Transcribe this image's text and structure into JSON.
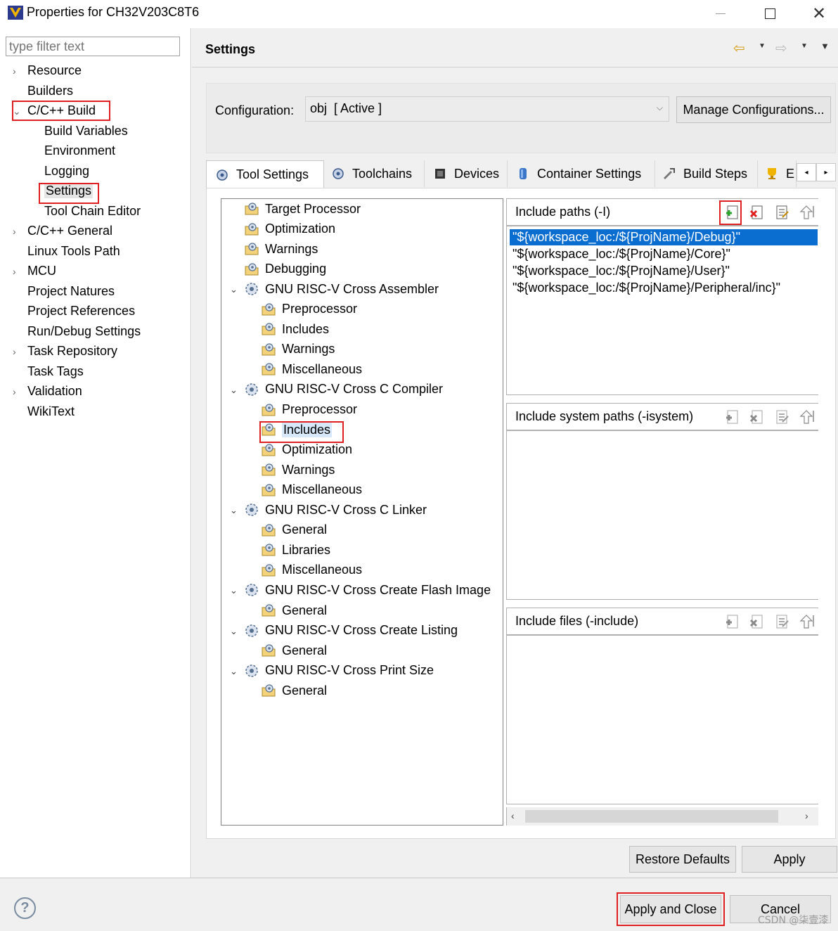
{
  "window": {
    "title": "Properties for CH32V203C8T6",
    "minimize_icon": "minimize-icon",
    "maximize_icon": "maximize-icon",
    "close_icon": "close-icon"
  },
  "filter": {
    "placeholder": "type filter text"
  },
  "nav": {
    "items": [
      {
        "label": "Resource",
        "expandable": true
      },
      {
        "label": "Builders",
        "expandable": false
      },
      {
        "label": "C/C++ Build",
        "expandable": true,
        "expanded": true
      },
      {
        "label": "Build Variables",
        "child": true
      },
      {
        "label": "Environment",
        "child": true
      },
      {
        "label": "Logging",
        "child": true
      },
      {
        "label": "Settings",
        "child": true,
        "selected": true
      },
      {
        "label": "Tool Chain Editor",
        "child": true
      },
      {
        "label": "C/C++ General",
        "expandable": true
      },
      {
        "label": "Linux Tools Path",
        "expandable": false
      },
      {
        "label": "MCU",
        "expandable": true
      },
      {
        "label": "Project Natures",
        "expandable": false
      },
      {
        "label": "Project References",
        "expandable": false
      },
      {
        "label": "Run/Debug Settings",
        "expandable": false
      },
      {
        "label": "Task Repository",
        "expandable": true
      },
      {
        "label": "Task Tags",
        "expandable": false
      },
      {
        "label": "Validation",
        "expandable": true
      },
      {
        "label": "WikiText",
        "expandable": false
      }
    ]
  },
  "header": {
    "title": "Settings"
  },
  "config": {
    "label": "Configuration:",
    "value": "obj  [ Active ]",
    "manage_label": "Manage Configurations..."
  },
  "tabs": [
    {
      "label": "Tool Settings",
      "icon": "tool-settings-icon",
      "active": true
    },
    {
      "label": "Toolchains",
      "icon": "toolchains-icon"
    },
    {
      "label": "Devices",
      "icon": "devices-icon"
    },
    {
      "label": "Container Settings",
      "icon": "container-icon"
    },
    {
      "label": "Build Steps",
      "icon": "build-steps-icon"
    },
    {
      "label": "E",
      "icon": "build-artifact-icon"
    }
  ],
  "tool_tree": [
    {
      "label": "Target Processor",
      "level": 0,
      "kind": "leaf"
    },
    {
      "label": "Optimization",
      "level": 0,
      "kind": "leaf"
    },
    {
      "label": "Warnings",
      "level": 0,
      "kind": "leaf"
    },
    {
      "label": "Debugging",
      "level": 0,
      "kind": "leaf"
    },
    {
      "label": "GNU RISC-V Cross Assembler",
      "level": 0,
      "kind": "group"
    },
    {
      "label": "Preprocessor",
      "level": 1,
      "kind": "leaf"
    },
    {
      "label": "Includes",
      "level": 1,
      "kind": "leaf"
    },
    {
      "label": "Warnings",
      "level": 1,
      "kind": "leaf"
    },
    {
      "label": "Miscellaneous",
      "level": 1,
      "kind": "leaf"
    },
    {
      "label": "GNU RISC-V Cross C Compiler",
      "level": 0,
      "kind": "group"
    },
    {
      "label": "Preprocessor",
      "level": 1,
      "kind": "leaf"
    },
    {
      "label": "Includes",
      "level": 1,
      "kind": "leaf",
      "selected": true
    },
    {
      "label": "Optimization",
      "level": 1,
      "kind": "leaf"
    },
    {
      "label": "Warnings",
      "level": 1,
      "kind": "leaf"
    },
    {
      "label": "Miscellaneous",
      "level": 1,
      "kind": "leaf"
    },
    {
      "label": "GNU RISC-V Cross C Linker",
      "level": 0,
      "kind": "group"
    },
    {
      "label": "General",
      "level": 1,
      "kind": "leaf"
    },
    {
      "label": "Libraries",
      "level": 1,
      "kind": "leaf"
    },
    {
      "label": "Miscellaneous",
      "level": 1,
      "kind": "leaf"
    },
    {
      "label": "GNU RISC-V Cross Create Flash Image",
      "level": 0,
      "kind": "group"
    },
    {
      "label": "General",
      "level": 1,
      "kind": "leaf"
    },
    {
      "label": "GNU RISC-V Cross Create Listing",
      "level": 0,
      "kind": "group"
    },
    {
      "label": "General",
      "level": 1,
      "kind": "leaf"
    },
    {
      "label": "GNU RISC-V Cross Print Size",
      "level": 0,
      "kind": "group"
    },
    {
      "label": "General",
      "level": 1,
      "kind": "leaf"
    }
  ],
  "panels": [
    {
      "title": "Include paths (-I)",
      "enabled": true,
      "items": [
        "\"${workspace_loc:/${ProjName}/Debug}\"",
        "\"${workspace_loc:/${ProjName}/Core}\"",
        "\"${workspace_loc:/${ProjName}/User}\"",
        "\"${workspace_loc:/${ProjName}/Peripheral/inc}\""
      ]
    },
    {
      "title": "Include system paths (-isystem)",
      "enabled": false,
      "items": []
    },
    {
      "title": "Include files (-include)",
      "enabled": false,
      "items": []
    }
  ],
  "panel_tools": [
    "add-icon",
    "delete-icon",
    "edit-icon",
    "move-up-icon"
  ],
  "buttons": {
    "restore_defaults": "Restore Defaults",
    "apply": "Apply",
    "apply_and_close": "Apply and Close",
    "cancel": "Cancel",
    "help": "?"
  },
  "watermark": "CSDN @柒壹漆",
  "colors": {
    "selection": "#0a6ed1",
    "highlight_box": "#e02020",
    "back_arrow": "#d4a017"
  }
}
